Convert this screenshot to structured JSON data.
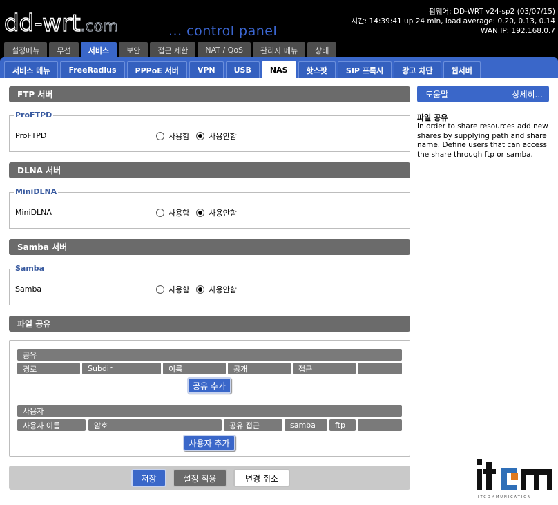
{
  "header": {
    "logo_main": "dd-wrt",
    "logo_suffix": ".com",
    "subtitle": "... control panel",
    "firmware": "펌웨어: DD-WRT v24-sp2 (03/07/15)",
    "time": "시간: 14:39:41 up 24 min, load average: 0.20, 0.13, 0.14",
    "wan_ip": "WAN IP: 192.168.0.7"
  },
  "tabs_main": [
    "설정메뉴",
    "무선",
    "서비스",
    "보안",
    "접근 제한",
    "NAT / QoS",
    "관리자 메뉴",
    "상태"
  ],
  "tabs_main_active": 2,
  "tabs_sub": [
    "서비스 메뉴",
    "FreeRadius",
    "PPPoE 서버",
    "VPN",
    "USB",
    "NAS",
    "핫스팟",
    "SIP 프록시",
    "광고 차단",
    "웹서버"
  ],
  "tabs_sub_active": 5,
  "sections": {
    "ftp": {
      "title": "FTP 서버",
      "legend": "ProFTPD",
      "label": "ProFTPD",
      "enabled": false
    },
    "dlna": {
      "title": "DLNA 서버",
      "legend": "MiniDLNA",
      "label": "MiniDLNA",
      "enabled": false
    },
    "samba": {
      "title": "Samba 서버",
      "legend": "Samba",
      "label": "Samba",
      "enabled": false
    },
    "share": {
      "title": "파일 공유",
      "shares_header": "공유",
      "shares_columns": [
        "경로",
        "Subdir",
        "이름",
        "공개",
        "접근",
        ""
      ],
      "add_share_label": "공유 추가",
      "users_header": "사용자",
      "users_columns": [
        "사용자 이름",
        "암호",
        "공유 접근",
        "samba",
        "ftp",
        ""
      ],
      "add_user_label": "사용자 추가"
    }
  },
  "radio_labels": {
    "enable": "사용함",
    "disable": "사용안함"
  },
  "footer": {
    "save": "저장",
    "apply": "설정 적용",
    "cancel": "변경 취소"
  },
  "help": {
    "header": "도움말",
    "more": "상세히...",
    "title": "파일 공유",
    "text": "In order to share resources add new shares by supplying path and share name. Define users that can access the share through ftp or samba."
  },
  "watermark": {
    "logo": "itcm",
    "sub": "ITCOMMUNICATION"
  },
  "colors": {
    "accent": "#3a67c9",
    "section_bar": "#6b6b6b",
    "legend": "#3a5ba0"
  }
}
